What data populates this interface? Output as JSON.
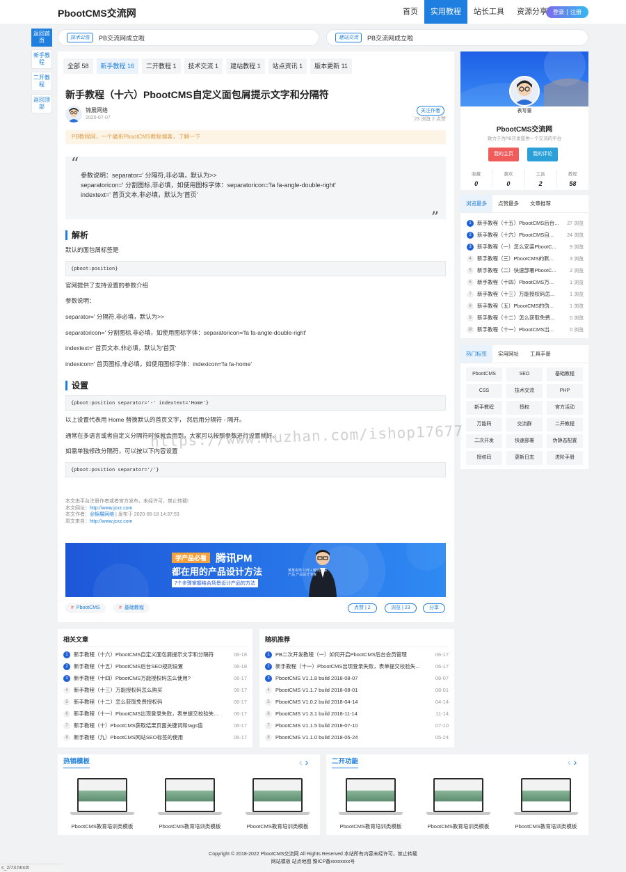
{
  "header": {
    "logo": "PbootCMS交流网",
    "nav": [
      "首页",
      "实用教程",
      "站长工具",
      "资源分享"
    ],
    "login": "登录",
    "register": "注册"
  },
  "sidebar": [
    {
      "label": "返回首页"
    },
    {
      "label": "新手教程"
    },
    {
      "label": "二开教程"
    },
    {
      "label": "返回顶部"
    }
  ],
  "notices": [
    {
      "tag": "技术公告",
      "text": "PB交流网成立啦"
    },
    {
      "tag": "建站交流",
      "text": "PB交流网成立啦"
    }
  ],
  "tabs": [
    "全部 58",
    "新手教程 16",
    "二开教程 1",
    "技术交流 1",
    "建站教程 1",
    "站点资讯 1",
    "版本更新 11"
  ],
  "article": {
    "title": "新手教程（十六）PbootCMS自定义面包屑提示文字和分隔符",
    "author": "锦展网络",
    "date": "2020-07-07",
    "follow": "关注作者",
    "stats": "23 浏览  2 点赞",
    "tip": "PB教程网，一个痛系PbootCMS教程偏客，了解一下",
    "quote": [
      "参数说明：separator=' 分隔符,非必填，默认为>>",
      "separatoricon=' 分割图标,非必填，如使用图标字体：separatoricon='fa fa-angle-double-right'",
      "indextext=' 首页文本,非必填，默认为'首页'"
    ],
    "h_parse": "解析",
    "p1": "默认的面包屑标签是",
    "code1": "{pboot:position}",
    "p2": "官网提供了支持设置的参数介绍",
    "p3": "参数说明：",
    "p4": "separator=' 分隔符,非必填，默认为>>",
    "p5": "separatoricon=' 分割图标,非必填，如使用图标字体：separatoricon='fa fa-angle-double-right'",
    "p6": "indextext=' 首页文本,非必填，默认为'首页'",
    "p7": "indexicon=' 首页图标,非必填，如使用图标字体：indexicon='fa fa-home'",
    "h_set": "设置",
    "code2": "{pboot:position separator='-' indextext='Home'}",
    "p8": "以上设置代表用 Home 替换默认的首页文字， 然后用分隔符 - 隔开。",
    "p9": "通常在多语言或者自定义分隔符时候就会用到，大家可以按照参数进行设置就好。",
    "p10": "如需单独修改分隔符，可以按以下内容设置",
    "code3": "{pboot:position separator='/'}",
    "meta1": "本文由平台注册作者或者官方发布，未经许可，禁止转载!",
    "meta2_label": "本文网址：",
    "meta2_link": "http://www.jcxz.com",
    "meta3_label": "本文作者：",
    "meta3_link": "@锦展网络",
    "meta3_rest": " | 发布于 2020-06-18 14:37:53",
    "meta4_label": "原文来自：",
    "meta4_link": "http://www.jcxz.com",
    "banner": {
      "tag": "学产品必看",
      "brand": "腾讯PM",
      "headline": "都在用的产品设计方法",
      "sub": "7个步骤掌握结合场景设计产品的方法",
      "info": "某某讲师 10年+ 腾讯资深产品 产品设计专家"
    },
    "tags": [
      "PbootCMS",
      "基础教程"
    ],
    "like": "点赞 | 2",
    "views": "浏览 | 23",
    "share": "分享"
  },
  "profile": {
    "avatar_text": "表写量",
    "name": "PbootCMS交流网",
    "desc": "致力于为PB开发提供一个交流的平台",
    "btn1": "我的主页",
    "btn2": "我的评论",
    "stats": [
      {
        "label": "收藏",
        "value": "0"
      },
      {
        "label": "喜欢",
        "value": "0"
      },
      {
        "label": "工具",
        "value": "2"
      },
      {
        "label": "教程",
        "value": "58"
      }
    ]
  },
  "ranking": {
    "tabs": [
      "浏览最多",
      "点赞最多",
      "文章推荐"
    ],
    "items": [
      {
        "n": "1",
        "t": "新手教程（十五）PbootCMS后台...",
        "c": "27 浏览"
      },
      {
        "n": "2",
        "t": "新手教程（十六）PbootCMS自...",
        "c": "24 浏览"
      },
      {
        "n": "3",
        "t": "新手教程（一）怎么安装PbootC...",
        "c": "9 浏览"
      },
      {
        "n": "4",
        "t": "新手教程（三）PbootCMS的默...",
        "c": "3 浏览"
      },
      {
        "n": "5",
        "t": "新手教程（二）快速部署PbootC...",
        "c": "2 浏览"
      },
      {
        "n": "6",
        "t": "新手教程（十四）PbootCMS万...",
        "c": "1 浏览"
      },
      {
        "n": "7",
        "t": "新手教程（十三）万能授权码怎...",
        "c": "1 浏览"
      },
      {
        "n": "8",
        "t": "新手教程（五）PbootCMS的伪...",
        "c": "1 浏览"
      },
      {
        "n": "9",
        "t": "新手教程（十二）怎么获取免费...",
        "c": "0 浏览"
      },
      {
        "n": "10",
        "t": "新手教程（十一）PbootCMS出...",
        "c": "0 浏览"
      }
    ]
  },
  "hottags": {
    "tabs": [
      "热门标签",
      "实用网址",
      "工具手册"
    ],
    "items": [
      "PbootCMS",
      "SEO",
      "基础教程",
      "CSS",
      "技术交流",
      "PHP",
      "新手教程",
      "授权",
      "官方活动",
      "万能码",
      "交流群",
      "二开教程",
      "二次开发",
      "快速部署",
      "伪静态配置",
      "授权码",
      "更新日志",
      "进阶手册"
    ]
  },
  "related": {
    "title": "相关文章",
    "items": [
      {
        "t": "新手教程（十六）PbootCMS自定义面包屑提示文字和分隔符",
        "d": "06-18"
      },
      {
        "t": "新手教程（十五）PbootCMS后台SEO规则设置",
        "d": "06-18"
      },
      {
        "t": "新手教程（十四）PbootCMS万能授权码怎么使用?",
        "d": "06-17"
      },
      {
        "t": "新手教程（十三）万能授权码怎么购买",
        "d": "06-17"
      },
      {
        "t": "新手教程（十二）怎么获取免费授权码",
        "d": "06-17"
      },
      {
        "t": "新手教程（十一）PbootCMS出现登录失败，表单提交校验失...",
        "d": "06-17"
      },
      {
        "t": "新手教程（十）PbootCMS获取结果页面关键词和tags值",
        "d": "06-17"
      },
      {
        "t": "新手教程（九）PbootCMS网站SEO标签的使用",
        "d": "06-17"
      }
    ]
  },
  "random": {
    "title": "随机推荐",
    "items": [
      {
        "t": "PB二次开发教程（一）如何开启PbootCMS后台会员管理",
        "d": "06-17"
      },
      {
        "t": "新手教程（十一）PbootCMS出现登录失败，表单提交校验失...",
        "d": "06-17"
      },
      {
        "t": "PbootCMS V1.1.8 build 2018-08-07",
        "d": "08-07"
      },
      {
        "t": "PbootCMS V1.1.7 build 2018-08-01",
        "d": "08-01"
      },
      {
        "t": "PbootCMS V1.0.2 build 2018-04-14",
        "d": "04-14"
      },
      {
        "t": "PbootCMS V1.3.1 build 2018-11-14",
        "d": "11-14"
      },
      {
        "t": "PbootCMS V1.1.5 build 2018-07-10",
        "d": "07-10"
      },
      {
        "t": "PbootCMS V1.1.0 build 2018-05-24",
        "d": "05-24"
      }
    ]
  },
  "templates_left": {
    "title": "热销模板",
    "items": [
      "PbootCMS教育培训类模板",
      "PbootCMS教育培训类模板",
      "PbootCMS教育培训类模板"
    ]
  },
  "templates_right": {
    "title": "二开功能",
    "items": [
      "PbootCMS教育培训类模板",
      "PbootCMS教育培训类模板",
      "PbootCMS教育培训类模板"
    ]
  },
  "footer": {
    "line1": "Copyright © 2018-2022   PbootCMS交流网 All Rights Reserved    本站所有内容未经许可，禁止转载",
    "line2": "网站模板  站点地图  豫ICP备xxxxxxxx号"
  },
  "watermark": "https://www.huzhan.com/ishop17677",
  "statusbar": "s_2/73.html#"
}
